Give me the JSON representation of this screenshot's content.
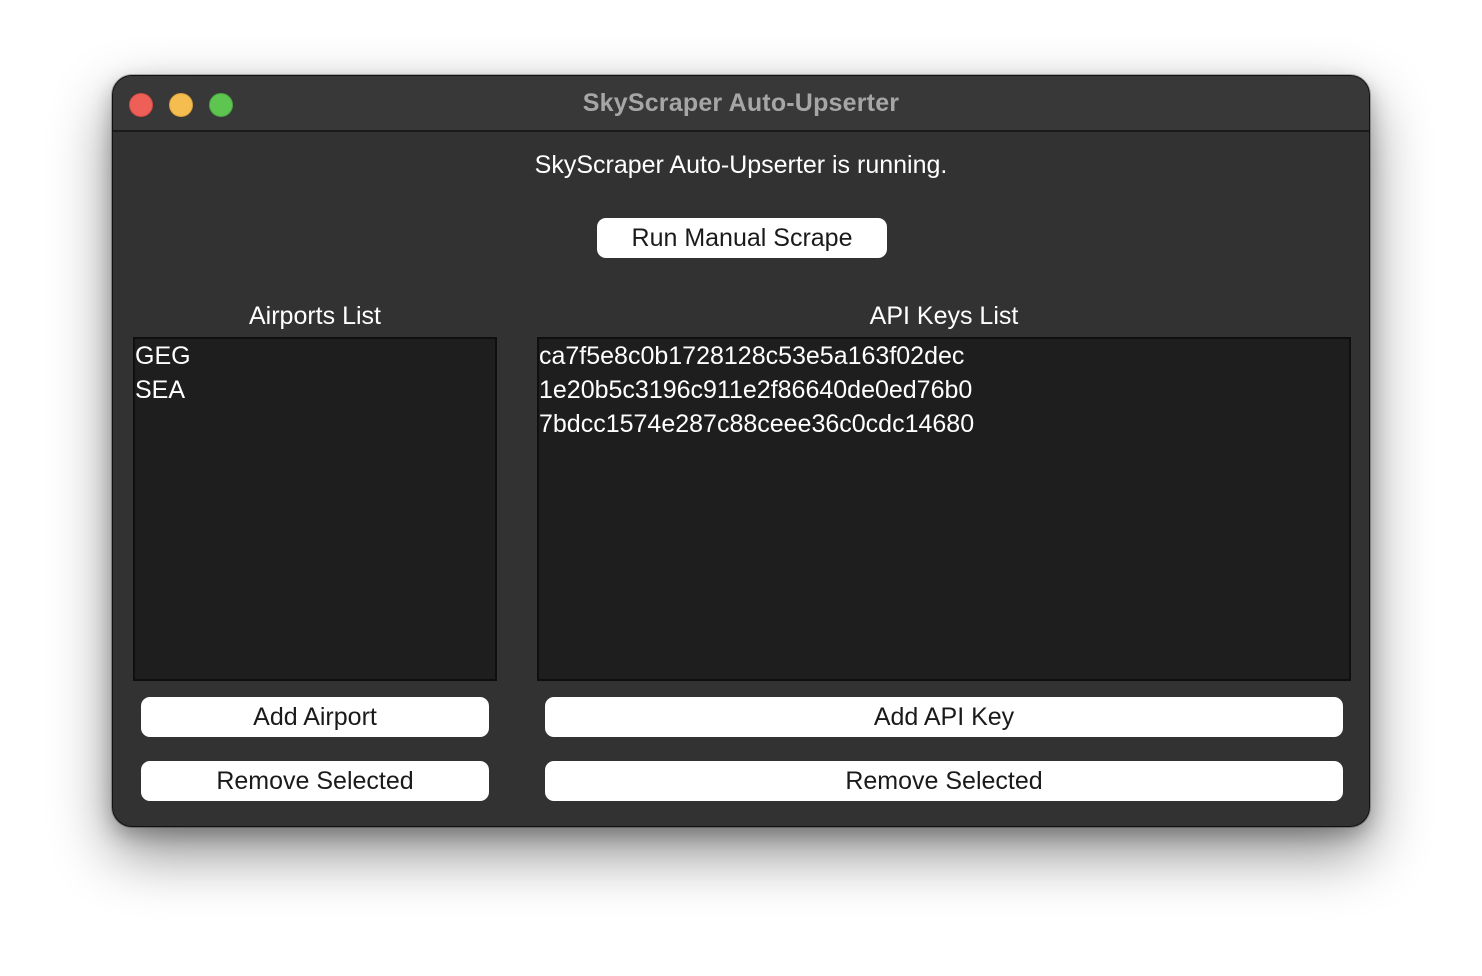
{
  "window": {
    "title": "SkyScraper Auto-Upserter"
  },
  "status_text": "SkyScraper Auto-Upserter is running.",
  "run_button_label": "Run Manual Scrape",
  "airports": {
    "label": "Airports List",
    "items": [
      "GEG",
      "SEA"
    ],
    "add_label": "Add Airport",
    "remove_label": "Remove Selected"
  },
  "api_keys": {
    "label": "API Keys List",
    "items": [
      "ca7f5e8c0b1728128c53e5a163f02dec",
      "1e20b5c3196c911e2f86640de0ed76b0",
      "7bdcc1574e287c88ceee36c0cdc14680"
    ],
    "add_label": "Add API Key",
    "remove_label": "Remove Selected"
  },
  "colors": {
    "close": "#ed5f57",
    "minimize": "#f5bd4f",
    "zoom": "#5dc550",
    "window_bg": "#323232",
    "list_bg": "#1e1e1e"
  }
}
